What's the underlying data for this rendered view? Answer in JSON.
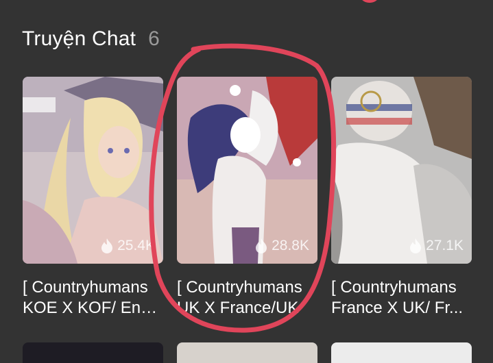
{
  "section": {
    "title": "Truyện Chat",
    "count": "6"
  },
  "cards": [
    {
      "views": "25.4K",
      "line1": "[ Countryhumans",
      "line2": "KOE X KOF/ Eng..."
    },
    {
      "views": "28.8K",
      "line1": "[ Countryhumans",
      "line2": "UK X France/UK"
    },
    {
      "views": "27.1K",
      "line1": "[ Countryhumans",
      "line2": "France X UK/ Fr..."
    }
  ],
  "colors": {
    "background": "#333333",
    "annotation": "#e0455a"
  }
}
